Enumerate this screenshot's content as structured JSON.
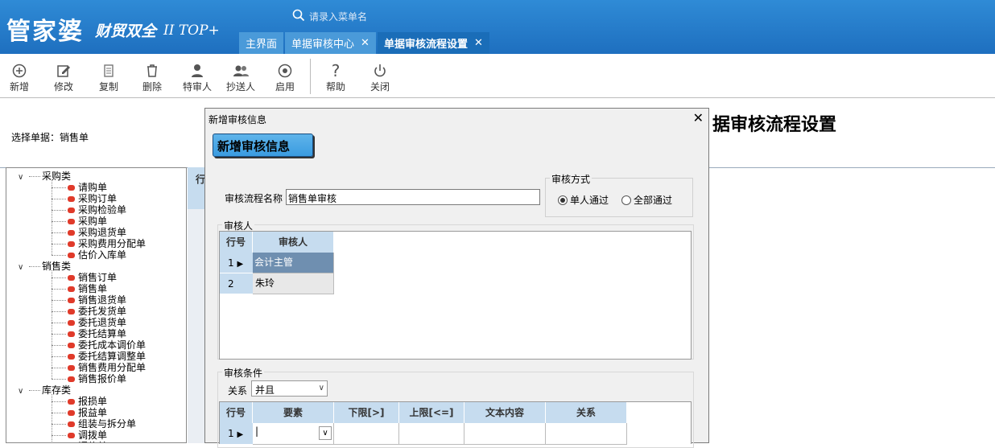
{
  "app": {
    "logo": "管家婆",
    "logo_sub": "财贸双全",
    "logo_ver": "II TOP+",
    "search_placeholder": "请录入菜单名"
  },
  "tabs": [
    {
      "label": "主界面"
    },
    {
      "label": "单据审核中心",
      "close": "✕"
    },
    {
      "label": "单据审核流程设置",
      "close": "✕"
    }
  ],
  "toolbar": {
    "add": "新增",
    "edit": "修改",
    "copy": "复制",
    "delete": "删除",
    "special": "特审人",
    "cc": "抄送人",
    "enable": "启用",
    "help": "帮助",
    "close": "关闭"
  },
  "page": {
    "select_bill": "选择单据：销售单",
    "title": "据审核流程设置",
    "grid_header_partial": "行"
  },
  "tree": {
    "categories": [
      {
        "label": "采购类",
        "toggle": "∨",
        "items": [
          "请购单",
          "采购订单",
          "采购检验单",
          "采购单",
          "采购退货单",
          "采购费用分配单",
          "估价入库单"
        ]
      },
      {
        "label": "销售类",
        "toggle": "∨",
        "items": [
          "销售订单",
          "销售单",
          "销售退货单",
          "委托发货单",
          "委托退货单",
          "委托结算单",
          "委托成本调价单",
          "委托结算调整单",
          "销售费用分配单",
          "销售报价单"
        ]
      },
      {
        "label": "库存类",
        "toggle": "∨",
        "items": [
          "报损单",
          "报益单",
          "组装与拆分单",
          "调拨单",
          "调价单"
        ]
      }
    ]
  },
  "dialog": {
    "title": "新增审核信息",
    "close": "✕",
    "header": "新增审核信息",
    "flow_name_label": "审核流程名称",
    "flow_name_value": "销售单审核",
    "mode_legend": "审核方式",
    "mode_single": "单人通过",
    "mode_all": "全部通过",
    "mode_selected": "single",
    "auditor_legend": "审核人",
    "auditor_headers": [
      "行号",
      "审核人"
    ],
    "auditors": [
      {
        "row": "1",
        "name": "会计主管"
      },
      {
        "row": "2",
        "name": "朱玲"
      }
    ],
    "cond_legend": "审核条件",
    "relation_label": "关系",
    "relation_value": "并且",
    "cond_headers": [
      "行号",
      "要素",
      "下限[>]",
      "上限[<=]",
      "文本内容",
      "关系"
    ],
    "cond_rows": [
      {
        "row": "1",
        "value": "|"
      }
    ]
  }
}
